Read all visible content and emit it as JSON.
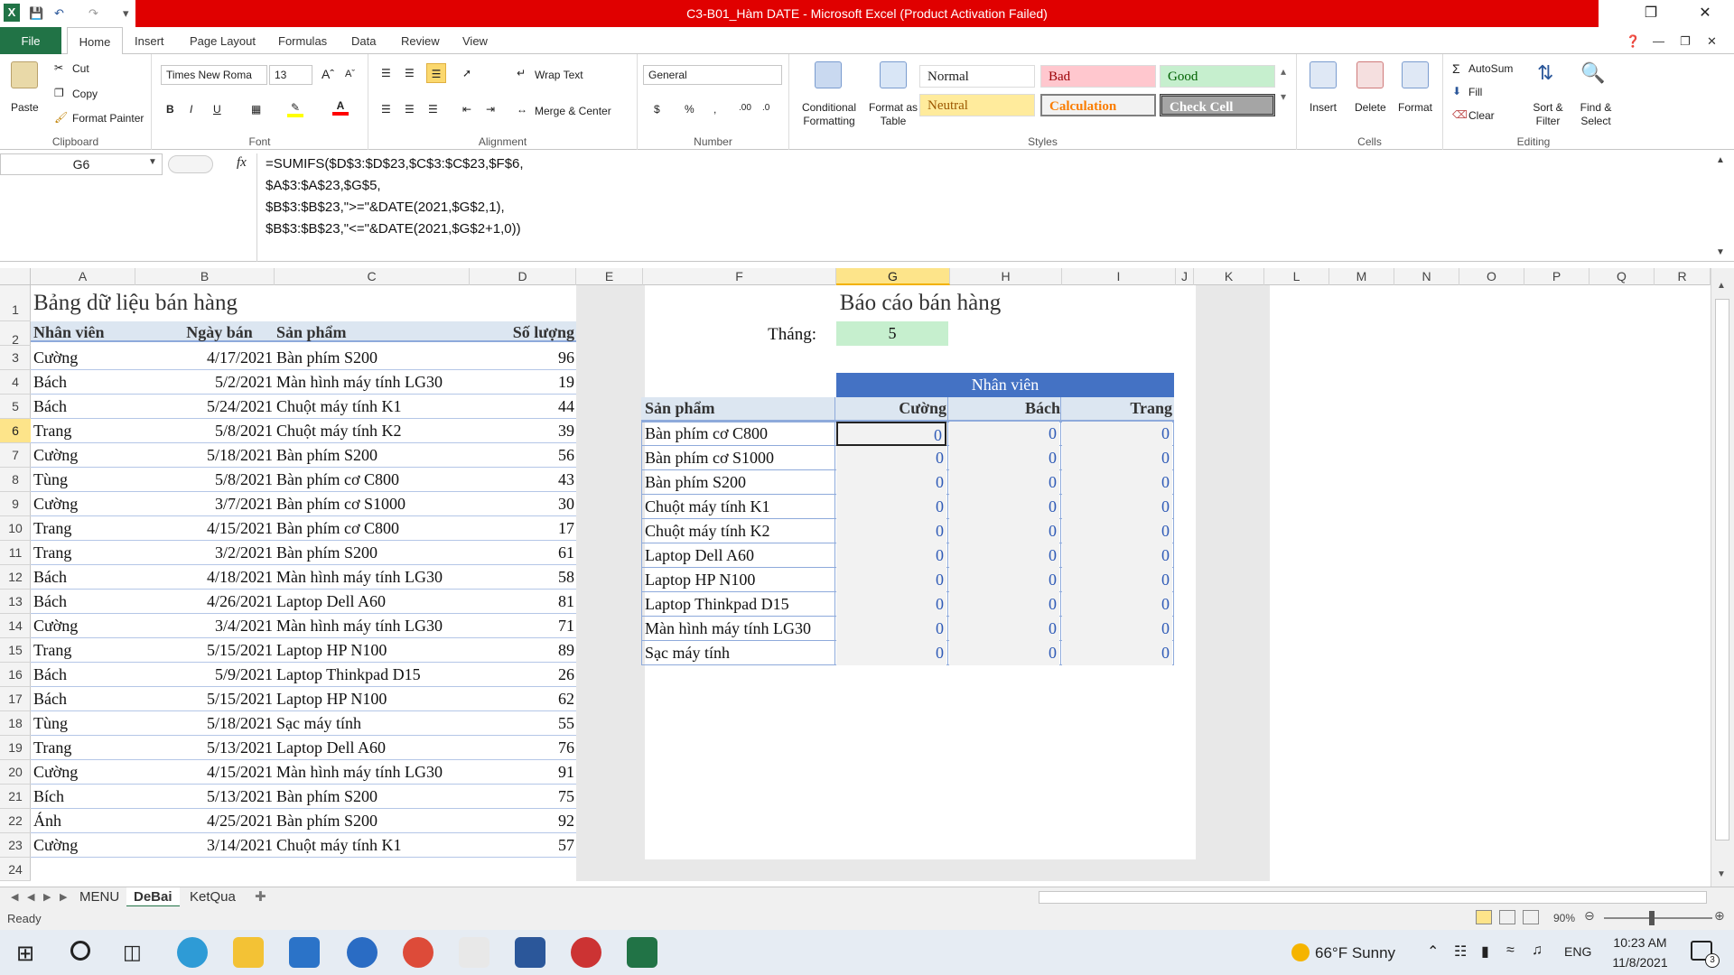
{
  "window": {
    "title": "C3-B01_Hàm DATE - Microsoft Excel (Product Activation Failed)"
  },
  "ribbon_tabs": [
    "File",
    "Home",
    "Insert",
    "Page Layout",
    "Formulas",
    "Data",
    "Review",
    "View"
  ],
  "clipboard": {
    "paste": "Paste",
    "cut": "Cut",
    "copy": "Copy",
    "format_painter": "Format Painter",
    "label": "Clipboard"
  },
  "font": {
    "name": "Times New Roma",
    "size": "13",
    "label": "Font"
  },
  "alignment": {
    "wrap": "Wrap Text",
    "merge": "Merge & Center",
    "label": "Alignment"
  },
  "number": {
    "format": "General",
    "label": "Number"
  },
  "styles": {
    "conditional": "Conditional Formatting",
    "format_table": "Format as Table",
    "normal": "Normal",
    "bad": "Bad",
    "good": "Good",
    "neutral": "Neutral",
    "calculation": "Calculation",
    "check_cell": "Check Cell",
    "label": "Styles"
  },
  "cells": {
    "insert": "Insert",
    "delete": "Delete",
    "format": "Format",
    "label": "Cells"
  },
  "editing": {
    "autosum": "AutoSum",
    "fill": "Fill",
    "clear": "Clear",
    "sort": "Sort & Filter",
    "find": "Find & Select",
    "label": "Editing"
  },
  "formula_bar": {
    "name_box": "G6",
    "fx": "fx",
    "formula": "=SUMIFS($D$3:$D$23,$C$3:$C$23,$F$6,\n$A$3:$A$23,$G$5,\n$B$3:$B$23,\">=\"&DATE(2021,$G$2,1),\n$B$3:$B$23,\"<=\"&DATE(2021,$G$2+1,0))"
  },
  "columns": [
    "A",
    "B",
    "C",
    "D",
    "E",
    "F",
    "G",
    "H",
    "I",
    "J",
    "K",
    "L",
    "M",
    "N",
    "O",
    "P",
    "Q",
    "R"
  ],
  "rows": [
    "1",
    "2",
    "3",
    "4",
    "5",
    "6",
    "7",
    "8",
    "9",
    "10",
    "11",
    "12",
    "13",
    "14",
    "15",
    "16",
    "17",
    "18",
    "19",
    "20",
    "21",
    "22",
    "23",
    "24"
  ],
  "data_table": {
    "title": "Bảng dữ liệu bán hàng",
    "headers": [
      "Nhân viên",
      "Ngày bán",
      "Sản phẩm",
      "Số lượng"
    ],
    "rows": [
      [
        "Cường",
        "4/17/2021",
        "Bàn phím S200",
        "96"
      ],
      [
        "Bách",
        "5/2/2021",
        "Màn hình máy tính LG30",
        "19"
      ],
      [
        "Bách",
        "5/24/2021",
        "Chuột máy tính K1",
        "44"
      ],
      [
        "Trang",
        "5/8/2021",
        "Chuột máy tính K2",
        "39"
      ],
      [
        "Cường",
        "5/18/2021",
        "Bàn phím S200",
        "56"
      ],
      [
        "Tùng",
        "5/8/2021",
        "Bàn phím cơ C800",
        "43"
      ],
      [
        "Cường",
        "3/7/2021",
        "Bàn phím cơ S1000",
        "30"
      ],
      [
        "Trang",
        "4/15/2021",
        "Bàn phím cơ C800",
        "17"
      ],
      [
        "Trang",
        "3/2/2021",
        "Bàn phím S200",
        "61"
      ],
      [
        "Bách",
        "4/18/2021",
        "Màn hình máy tính LG30",
        "58"
      ],
      [
        "Bách",
        "4/26/2021",
        "Laptop Dell A60",
        "81"
      ],
      [
        "Cường",
        "3/4/2021",
        "Màn hình máy tính LG30",
        "71"
      ],
      [
        "Trang",
        "5/15/2021",
        "Laptop HP N100",
        "89"
      ],
      [
        "Bách",
        "5/9/2021",
        "Laptop Thinkpad D15",
        "26"
      ],
      [
        "Bách",
        "5/15/2021",
        "Laptop HP N100",
        "62"
      ],
      [
        "Tùng",
        "5/18/2021",
        "Sạc máy tính",
        "55"
      ],
      [
        "Trang",
        "5/13/2021",
        "Laptop Dell A60",
        "76"
      ],
      [
        "Cường",
        "4/15/2021",
        "Màn hình máy tính LG30",
        "91"
      ],
      [
        "Bích",
        "5/13/2021",
        "Bàn phím S200",
        "75"
      ],
      [
        "Ánh",
        "4/25/2021",
        "Bàn phím S200",
        "92"
      ],
      [
        "Cường",
        "3/14/2021",
        "Chuột máy tính K1",
        "57"
      ]
    ]
  },
  "report": {
    "title": "Báo cáo bán hàng",
    "month_label": "Tháng:",
    "month_value": "5",
    "group_header": "Nhân viên",
    "product_header": "Sản phẩm",
    "employees": [
      "Cường",
      "Bách",
      "Trang"
    ],
    "products": [
      "Bàn phím cơ C800",
      "Bàn phím cơ S1000",
      "Bàn phím S200",
      "Chuột máy tính K1",
      "Chuột máy tính K2",
      "Laptop Dell A60",
      "Laptop HP N100",
      "Laptop Thinkpad D15",
      "Màn hình máy tính LG30",
      "Sạc máy tính"
    ],
    "values": "0"
  },
  "sheet_tabs": [
    "MENU",
    "DeBai",
    "KetQua"
  ],
  "status": {
    "ready": "Ready",
    "zoom": "90%"
  },
  "taskbar": {
    "weather": "66°F  Sunny",
    "lang": "ENG",
    "time": "10:23 AM",
    "date": "11/8/2021",
    "notif": "3"
  }
}
